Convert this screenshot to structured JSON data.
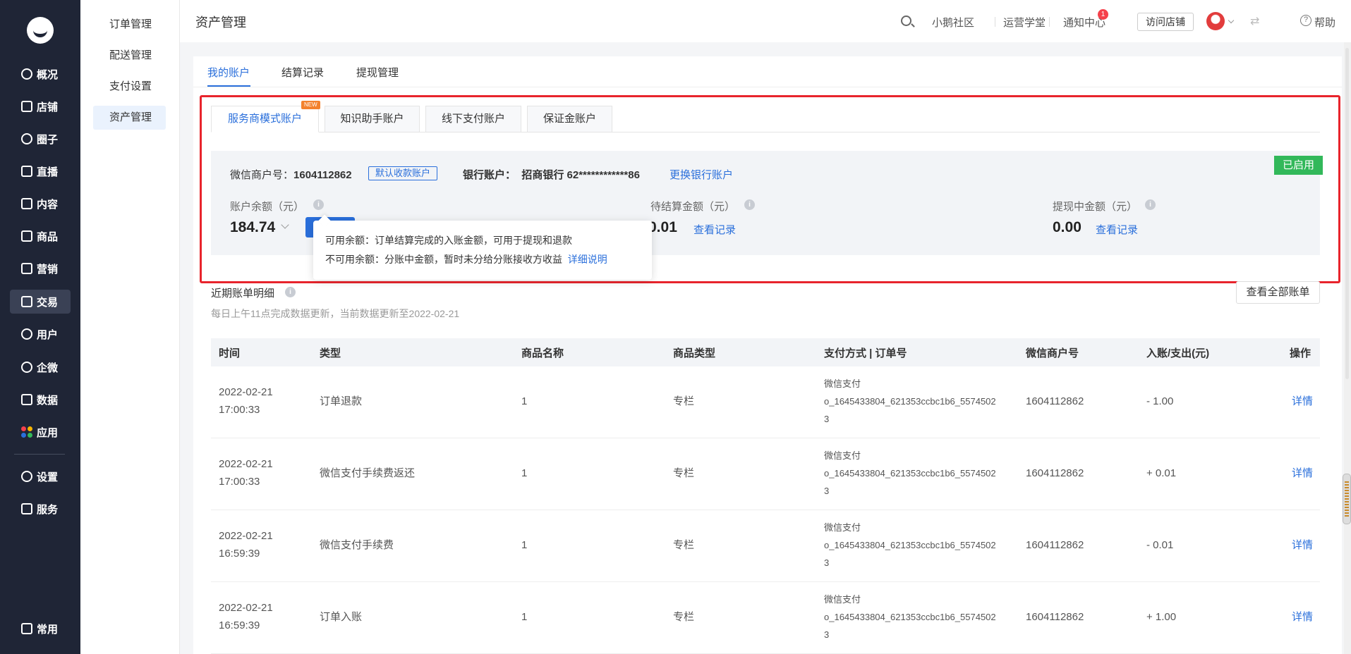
{
  "nav": {
    "items": [
      {
        "label": "概况",
        "icon": "pie-chart-icon"
      },
      {
        "label": "店铺",
        "icon": "store-icon"
      },
      {
        "label": "圈子",
        "icon": "community-icon"
      },
      {
        "label": "直播",
        "icon": "live-icon"
      },
      {
        "label": "内容",
        "icon": "content-icon"
      },
      {
        "label": "商品",
        "icon": "product-icon"
      },
      {
        "label": "营销",
        "icon": "megaphone-icon"
      },
      {
        "label": "交易",
        "icon": "transaction-icon"
      },
      {
        "label": "用户",
        "icon": "user-icon"
      },
      {
        "label": "企微",
        "icon": "wecom-icon"
      },
      {
        "label": "数据",
        "icon": "data-icon"
      },
      {
        "label": "应用",
        "icon": "apps-icon"
      },
      {
        "label": "设置",
        "icon": "gear-icon"
      },
      {
        "label": "服务",
        "icon": "service-icon"
      }
    ],
    "bottom": "常用"
  },
  "submenu": [
    "订单管理",
    "配送管理",
    "支付设置",
    "资产管理"
  ],
  "header": {
    "title": "资产管理",
    "links": [
      "小鹅社区",
      "运营学堂",
      "通知中心"
    ],
    "notif_count": "1",
    "visit_store": "访问店铺",
    "help": "帮助"
  },
  "tabs": [
    "我的账户",
    "结算记录",
    "提现管理"
  ],
  "account_tabs": [
    "服务商模式账户",
    "知识助手账户",
    "线下支付账户",
    "保证金账户"
  ],
  "new_badge": "NEW",
  "account": {
    "status": "已启用",
    "merchant_label": "微信商户号：",
    "merchant_no": "1604112862",
    "default_tag": "默认收款账户",
    "bank_label": "银行账户：",
    "bank_value": "招商银行 62************86",
    "change_bank": "更换银行账户",
    "balance_label": "账户余额（元）",
    "balance": "184.74",
    "pending_label": "待结算金额（元）",
    "pending": "0.01",
    "pending_link": "查看记录",
    "withdrawing_label": "提现中金额（元）",
    "withdrawing": "0.00",
    "withdrawing_link": "查看记录"
  },
  "tooltip": {
    "line1": "可用余额：订单结算完成的入账金额，可用于提现和退款",
    "line2": "不可用余额：分账中金额，暂时未分给分账接收方收益",
    "link": "详细说明"
  },
  "bills": {
    "title": "近期账单明细",
    "subtitle": "每日上午11点完成数据更新，当前数据更新至2022-02-21",
    "view_all": "查看全部账单",
    "columns": [
      "时间",
      "类型",
      "商品名称",
      "商品类型",
      "支付方式 | 订单号",
      "微信商户号",
      "入账/支出(元)",
      "操作"
    ],
    "rows": [
      {
        "date": "2022-02-21",
        "time": "17:00:33",
        "type": "订单退款",
        "name": "1",
        "ptype": "专栏",
        "pay": "微信支付",
        "order1": "o_1645433804_621353ccbc1b6_5574502",
        "order2": "3",
        "merchant": "1604112862",
        "amount": "- 1.00",
        "op": "详情"
      },
      {
        "date": "2022-02-21",
        "time": "17:00:33",
        "type": "微信支付手续费返还",
        "name": "1",
        "ptype": "专栏",
        "pay": "微信支付",
        "order1": "o_1645433804_621353ccbc1b6_5574502",
        "order2": "3",
        "merchant": "1604112862",
        "amount": "+ 0.01",
        "op": "详情"
      },
      {
        "date": "2022-02-21",
        "time": "16:59:39",
        "type": "微信支付手续费",
        "name": "1",
        "ptype": "专栏",
        "pay": "微信支付",
        "order1": "o_1645433804_621353ccbc1b6_5574502",
        "order2": "3",
        "merchant": "1604112862",
        "amount": "- 0.01",
        "op": "详情"
      },
      {
        "date": "2022-02-21",
        "time": "16:59:39",
        "type": "订单入账",
        "name": "1",
        "ptype": "专栏",
        "pay": "微信支付",
        "order1": "o_1645433804_621353ccbc1b6_5574502",
        "order2": "3",
        "merchant": "1604112862",
        "amount": "+ 1.00",
        "op": "详情"
      }
    ]
  },
  "colors": {
    "accent": "#2a6fdb",
    "nav_bg": "#1f2536",
    "enabled": "#32b85a",
    "highlight_frame": "#e8242c"
  }
}
